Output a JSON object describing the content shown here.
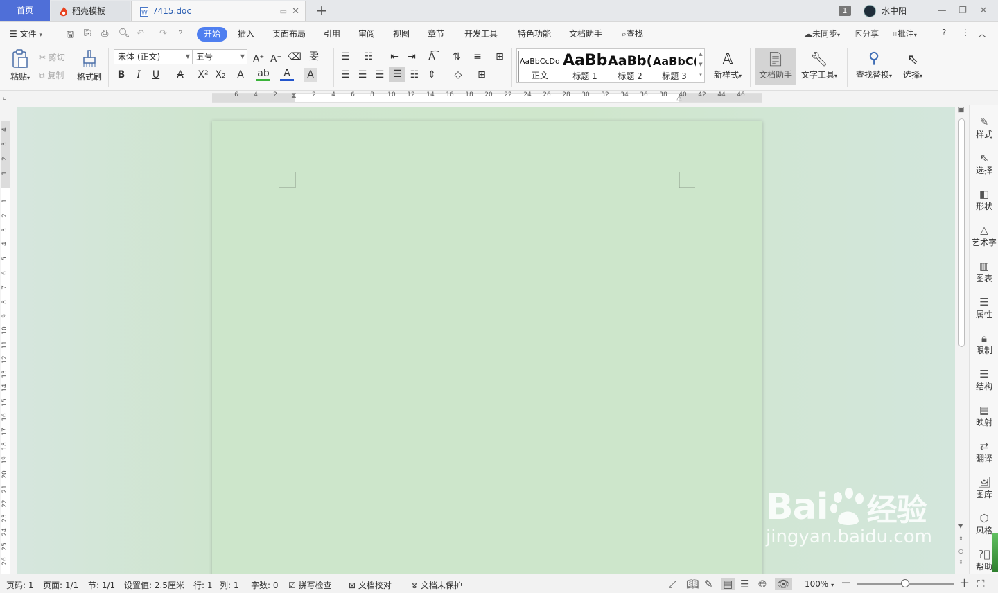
{
  "tabs": {
    "home": "首页",
    "template": "稻壳模板",
    "document": "7415.doc",
    "new_tab": "+"
  },
  "window": {
    "badge": "1",
    "user": "水中阳",
    "minimize": "—",
    "restore": "❐",
    "close": "✕"
  },
  "menu": {
    "file": "文件",
    "items": [
      "开始",
      "插入",
      "页面布局",
      "引用",
      "审阅",
      "视图",
      "章节",
      "开发工具",
      "特色功能",
      "文档助手"
    ],
    "search": "查找",
    "sync": "未同步",
    "share": "分享",
    "comment": "批注",
    "help": "?",
    "more": "⋮",
    "collapse": "︿"
  },
  "ribbon": {
    "paste": "粘贴",
    "cut": "剪切",
    "copy": "复制",
    "format_painter": "格式刷",
    "font_name": "宋体 (正文)",
    "font_size": "五号",
    "styles": [
      {
        "preview": "AaBbCcDd",
        "name": "正文"
      },
      {
        "preview": "AaBb",
        "name": "标题 1"
      },
      {
        "preview": "AaBb(",
        "name": "标题 2"
      },
      {
        "preview": "AaBbC(",
        "name": "标题 3"
      }
    ],
    "new_style": "新样式",
    "doc_assistant": "文档助手",
    "text_tools": "文字工具",
    "find_replace": "查找替换",
    "select": "选择"
  },
  "ruler": {
    "h_ticks": [
      "6",
      "4",
      "2",
      "2",
      "4",
      "6",
      "8",
      "10",
      "12",
      "14",
      "16",
      "18",
      "20",
      "22",
      "24",
      "26",
      "28",
      "30",
      "32",
      "34",
      "36",
      "38",
      "40",
      "42",
      "44",
      "46"
    ],
    "v_ticks": [
      "4",
      "3",
      "2",
      "1",
      "1",
      "2",
      "3",
      "4",
      "5",
      "6",
      "7",
      "8",
      "9",
      "10",
      "11",
      "12",
      "13",
      "14",
      "15",
      "16",
      "17",
      "18",
      "19",
      "20",
      "21",
      "22",
      "23",
      "24",
      "25",
      "26"
    ]
  },
  "right_panel": [
    "样式",
    "选择",
    "形状",
    "艺术字",
    "图表",
    "属性",
    "限制",
    "结构",
    "映射",
    "翻译",
    "图库",
    "风格",
    "帮助"
  ],
  "status": {
    "page_num": "页码: 1",
    "pages": "页面: 1/1",
    "section": "节: 1/1",
    "setting": "设置值: 2.5厘米",
    "row": "行: 1",
    "col": "列: 1",
    "words": "字数: 0",
    "spell": "拼写检查",
    "proof": "文档校对",
    "protect": "文档未保护",
    "zoom": "100%"
  },
  "watermark": {
    "brand": "Bai",
    "brand_cn": "经验",
    "url": "jingyan.baidu.com"
  },
  "colors": {
    "accent": "#4f7ff0",
    "home_tab": "#4f6fd8",
    "page": "#cde6cb"
  }
}
